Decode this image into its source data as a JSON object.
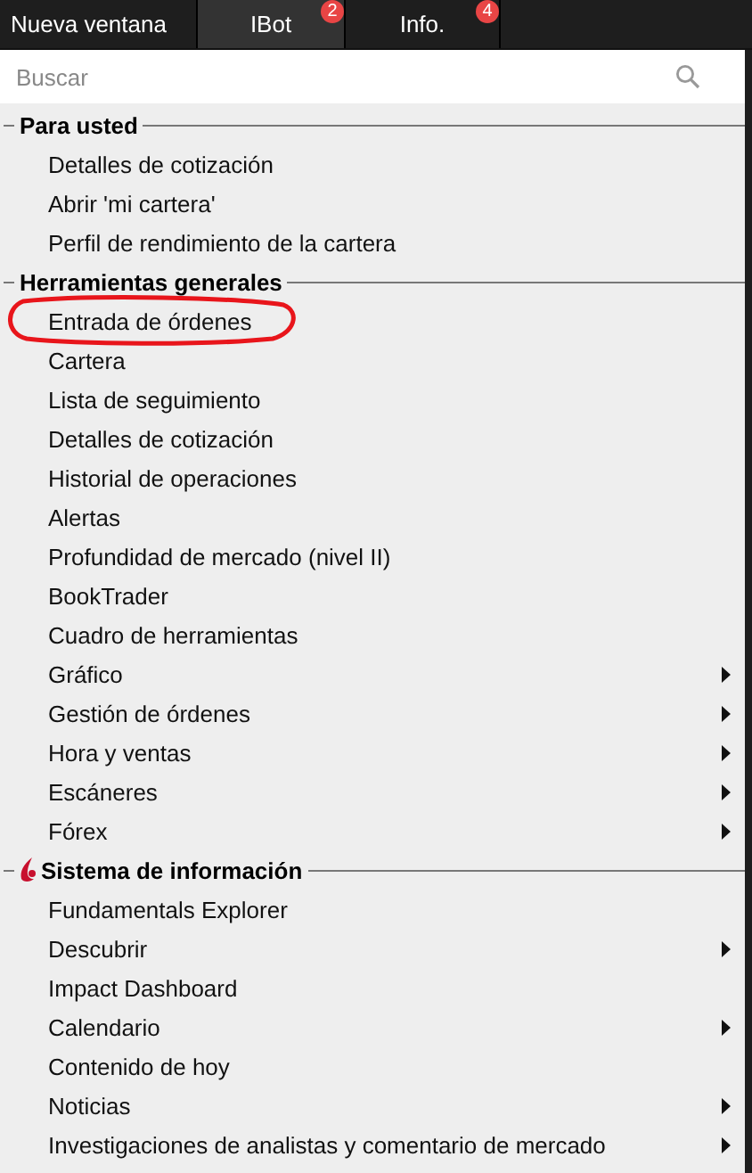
{
  "tabs": [
    {
      "label": "Nueva ventana",
      "selected": false
    },
    {
      "label": "IBot",
      "selected": true,
      "badge": "2"
    },
    {
      "label": "Info.",
      "selected": false,
      "badge": "4"
    }
  ],
  "search": {
    "placeholder": "Buscar"
  },
  "sections": [
    {
      "title": "Para usted",
      "logo": false,
      "items": [
        {
          "label": "Detalles de cotización",
          "submenu": false
        },
        {
          "label": "Abrir 'mi cartera'",
          "submenu": false
        },
        {
          "label": "Perfil de rendimiento de la cartera",
          "submenu": false
        }
      ]
    },
    {
      "title": "Herramientas generales",
      "logo": false,
      "items": [
        {
          "label": "Entrada de órdenes",
          "submenu": false,
          "circled": true
        },
        {
          "label": "Cartera",
          "submenu": false
        },
        {
          "label": "Lista de seguimiento",
          "submenu": false
        },
        {
          "label": "Detalles de cotización",
          "submenu": false
        },
        {
          "label": "Historial de operaciones",
          "submenu": false
        },
        {
          "label": "Alertas",
          "submenu": false
        },
        {
          "label": "Profundidad de mercado (nivel II)",
          "submenu": false
        },
        {
          "label": "BookTrader",
          "submenu": false
        },
        {
          "label": "Cuadro de herramientas",
          "submenu": false
        },
        {
          "label": "Gráfico",
          "submenu": true
        },
        {
          "label": "Gestión de órdenes",
          "submenu": true
        },
        {
          "label": "Hora y ventas",
          "submenu": true
        },
        {
          "label": "Escáneres",
          "submenu": true
        },
        {
          "label": "Fórex",
          "submenu": true
        }
      ]
    },
    {
      "title": "Sistema de información",
      "logo": true,
      "items": [
        {
          "label": "Fundamentals Explorer",
          "submenu": false
        },
        {
          "label": "Descubrir",
          "submenu": true
        },
        {
          "label": "Impact Dashboard",
          "submenu": false
        },
        {
          "label": "Calendario",
          "submenu": true
        },
        {
          "label": "Contenido de hoy",
          "submenu": false
        },
        {
          "label": "Noticias",
          "submenu": true
        },
        {
          "label": "Investigaciones de analistas y comentario de mercado",
          "submenu": true
        }
      ]
    }
  ]
}
